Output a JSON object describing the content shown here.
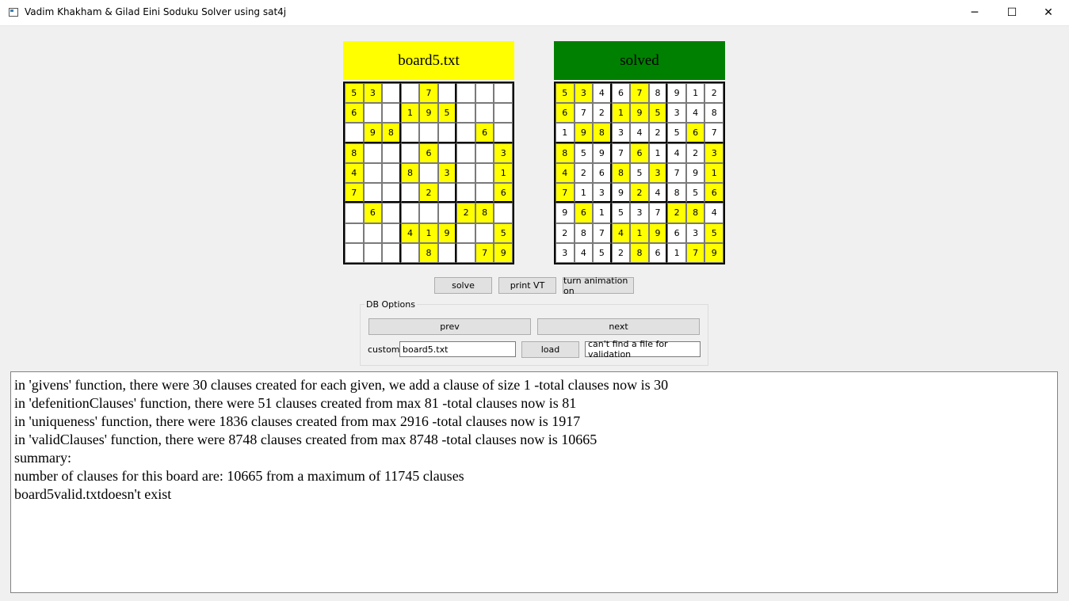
{
  "window": {
    "title": "Vadim Khakham & Gilad Eini Soduku Solver using sat4j",
    "minimize_glyph": "─",
    "maximize_glyph": "☐",
    "close_glyph": "✕"
  },
  "colors": {
    "given_cell": "#ffff00",
    "input_header": "#ffff00",
    "solved_header": "#008000"
  },
  "input_board": {
    "header": "board5.txt",
    "cells": [
      [
        "5",
        "3",
        "",
        "",
        "7",
        "",
        "",
        "",
        ""
      ],
      [
        "6",
        "",
        "",
        "1",
        "9",
        "5",
        "",
        "",
        ""
      ],
      [
        "",
        "9",
        "8",
        "",
        "",
        "",
        "",
        "6",
        ""
      ],
      [
        "8",
        "",
        "",
        "",
        "6",
        "",
        "",
        "",
        "3"
      ],
      [
        "4",
        "",
        "",
        "8",
        "",
        "3",
        "",
        "",
        "1"
      ],
      [
        "7",
        "",
        "",
        "",
        "2",
        "",
        "",
        "",
        "6"
      ],
      [
        "",
        "6",
        "",
        "",
        "",
        "",
        "2",
        "8",
        ""
      ],
      [
        "",
        "",
        "",
        "4",
        "1",
        "9",
        "",
        "",
        "5"
      ],
      [
        "",
        "",
        "",
        "",
        "8",
        "",
        "",
        "7",
        "9"
      ]
    ]
  },
  "solved_board": {
    "header": "solved",
    "cells": [
      [
        "5",
        "3",
        "4",
        "6",
        "7",
        "8",
        "9",
        "1",
        "2"
      ],
      [
        "6",
        "7",
        "2",
        "1",
        "9",
        "5",
        "3",
        "4",
        "8"
      ],
      [
        "1",
        "9",
        "8",
        "3",
        "4",
        "2",
        "5",
        "6",
        "7"
      ],
      [
        "8",
        "5",
        "9",
        "7",
        "6",
        "1",
        "4",
        "2",
        "3"
      ],
      [
        "4",
        "2",
        "6",
        "8",
        "5",
        "3",
        "7",
        "9",
        "1"
      ],
      [
        "7",
        "1",
        "3",
        "9",
        "2",
        "4",
        "8",
        "5",
        "6"
      ],
      [
        "9",
        "6",
        "1",
        "5",
        "3",
        "7",
        "2",
        "8",
        "4"
      ],
      [
        "2",
        "8",
        "7",
        "4",
        "1",
        "9",
        "6",
        "3",
        "5"
      ],
      [
        "3",
        "4",
        "5",
        "2",
        "8",
        "6",
        "1",
        "7",
        "9"
      ]
    ]
  },
  "toolbar": {
    "solve_label": "solve",
    "print_vt_label": "print VT",
    "animation_label": "turn animation on"
  },
  "db_options": {
    "group_label": "DB Options",
    "prev_label": "prev",
    "next_label": "next",
    "custom_label": "custom",
    "custom_value": "board5.txt",
    "load_label": "load",
    "validation_status": "can't find a file for validation"
  },
  "log": {
    "lines": [
      "in 'givens' function, there were 30 clauses created for each given, we add a clause of size 1 -total clauses now is 30",
      "in 'defenitionClauses' function, there were 51 clauses created from max 81 -total clauses now is 81",
      "in 'uniqueness' function, there were 1836 clauses created from max 2916 -total clauses now is 1917",
      "in 'validClauses' function, there were 8748 clauses created from max 8748 -total clauses now is 10665",
      "summary:",
      "number of clauses for this board are: 10665 from a maximum of 11745 clauses",
      "board5valid.txtdoesn't exist"
    ]
  }
}
